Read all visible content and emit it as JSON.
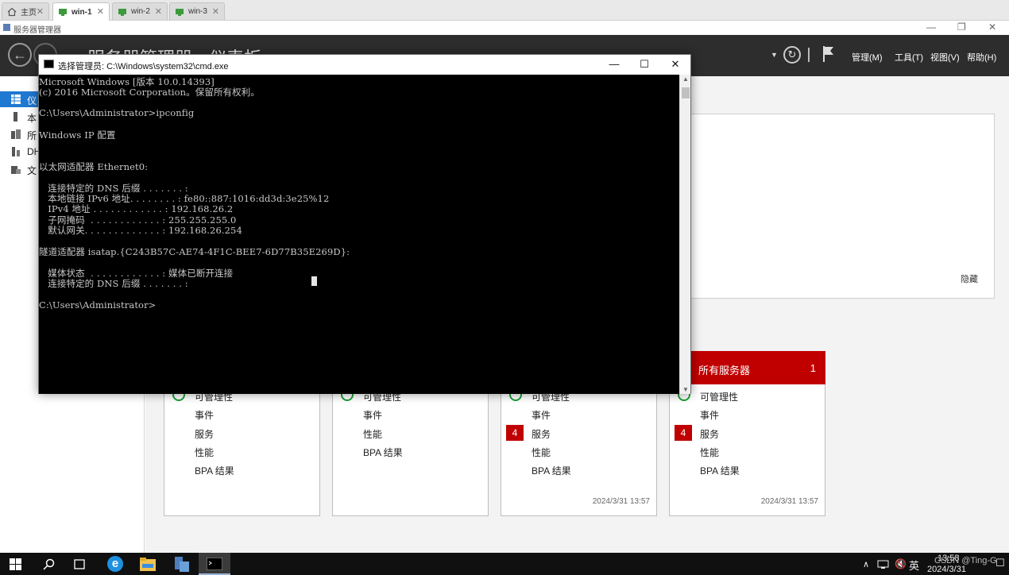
{
  "vm_tabs": [
    {
      "label": "主页",
      "icon": "home-icon",
      "active": false
    },
    {
      "label": "win-1",
      "icon": "vm-icon",
      "active": true
    },
    {
      "label": "win-2",
      "icon": "vm-icon",
      "active": false
    },
    {
      "label": "win-3",
      "icon": "vm-icon",
      "active": false
    }
  ],
  "server_manager": {
    "window_title": "服务器管理器",
    "title": "服务器管理器 · 仪表板",
    "menu": [
      "管理(M)",
      "工具(T)",
      "视图(V)",
      "帮助(H)"
    ],
    "nav": [
      {
        "label": "仪",
        "icon": "dashboard-icon",
        "selected": true
      },
      {
        "label": "本",
        "icon": "server-icon",
        "selected": false
      },
      {
        "label": "所",
        "icon": "servers-icon",
        "selected": false
      },
      {
        "label": "DH",
        "icon": "dhcp-icon",
        "selected": false
      },
      {
        "label": "文",
        "icon": "file-storage-icon",
        "selected": false
      }
    ],
    "hide_label": "隐藏",
    "tiles": [
      {
        "header": "",
        "count": "",
        "rows": [
          {
            "label": "可管理性",
            "badge": ""
          },
          {
            "label": "事件",
            "badge": ""
          },
          {
            "label": "服务",
            "badge": ""
          },
          {
            "label": "性能",
            "badge": ""
          },
          {
            "label": "BPA 结果",
            "badge": ""
          }
        ],
        "timestamp": ""
      },
      {
        "header": "",
        "count": "",
        "rows": [
          {
            "label": "可管理性",
            "badge": ""
          },
          {
            "label": "事件",
            "badge": ""
          },
          {
            "label": "性能",
            "badge": ""
          },
          {
            "label": "BPA 结果",
            "badge": ""
          }
        ],
        "timestamp": ""
      },
      {
        "header": "",
        "count": "",
        "rows": [
          {
            "label": "可管理性",
            "badge": ""
          },
          {
            "label": "事件",
            "badge": ""
          },
          {
            "label": "服务",
            "badge": "4"
          },
          {
            "label": "性能",
            "badge": ""
          },
          {
            "label": "BPA 结果",
            "badge": ""
          }
        ],
        "timestamp": "2024/3/31 13:57"
      },
      {
        "header": "所有服务器",
        "count": "1",
        "rows": [
          {
            "label": "可管理性",
            "badge": ""
          },
          {
            "label": "事件",
            "badge": ""
          },
          {
            "label": "服务",
            "badge": "4"
          },
          {
            "label": "性能",
            "badge": ""
          },
          {
            "label": "BPA 结果",
            "badge": ""
          }
        ],
        "timestamp": "2024/3/31 13:57"
      }
    ]
  },
  "cmd": {
    "title": "选择管理员: C:\\Windows\\system32\\cmd.exe",
    "lines": [
      "Microsoft Windows [版本 10.0.14393]",
      "(c) 2016 Microsoft Corporation。保留所有权利。",
      "",
      "C:\\Users\\Administrator>ipconfig",
      "",
      "Windows IP 配置",
      "",
      "",
      "以太网适配器 Ethernet0:",
      "",
      "   连接特定的 DNS 后缀 . . . . . . . :",
      "   本地链接 IPv6 地址. . . . . . . . : fe80::887:1016:dd3d:3e25%12",
      "   IPv4 地址 . . . . . . . . . . . . : 192.168.26.2",
      "   子网掩码  . . . . . . . . . . . . : 255.255.255.0",
      "   默认网关. . . . . . . . . . . . . : 192.168.26.254",
      "",
      "隧道适配器 isatap.{C243B57C-AE74-4F1C-BEE7-6D77B35E269D}:",
      "",
      "   媒体状态  . . . . . . . . . . . . : 媒体已断开连接",
      "   连接特定的 DNS 后缀 . . . . . . . :",
      "",
      "C:\\Users\\Administrator>"
    ]
  },
  "taskbar": {
    "apps": [
      "windows-start-icon",
      "search-icon",
      "task-view-icon",
      "edge-icon",
      "file-explorer-icon",
      "server-manager-icon",
      "cmd-icon"
    ],
    "ime": "英",
    "tray_time": "13:58",
    "tray_date": "2024/3/31",
    "watermark": "CSDN @Ting-G"
  }
}
